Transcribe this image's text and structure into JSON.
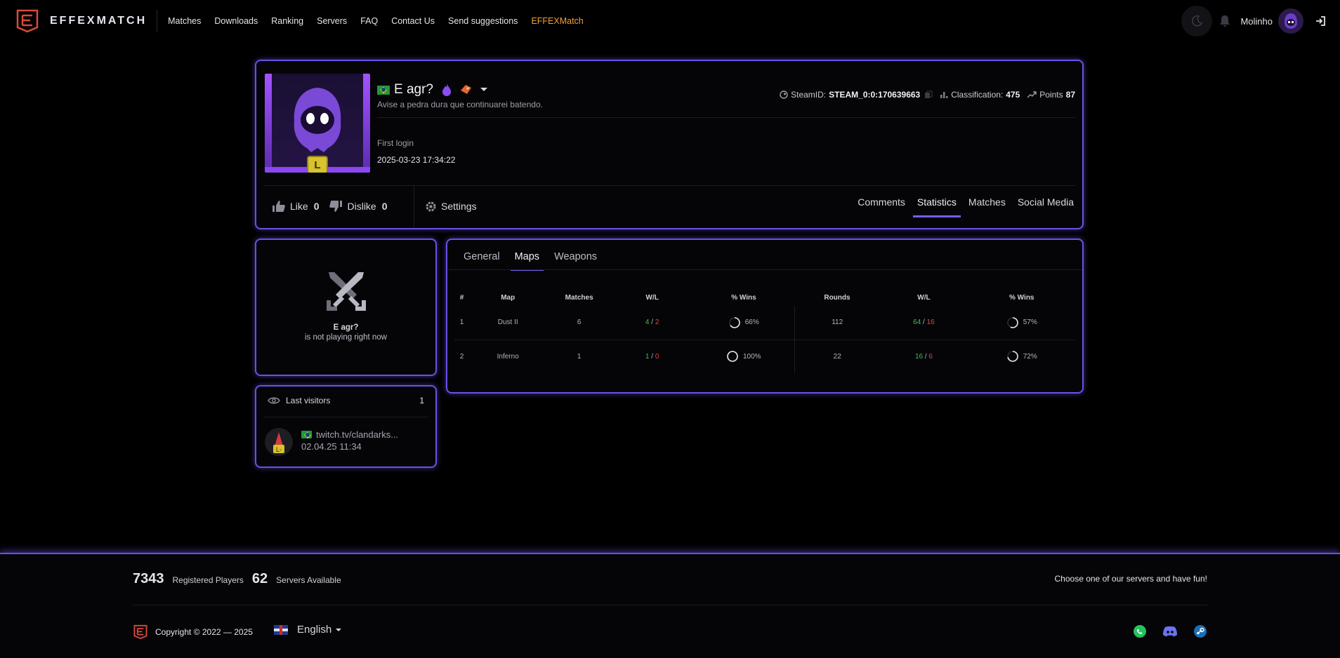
{
  "brand": {
    "name": "EFFEXMATCH",
    "accent": "#6b50e6",
    "brand_link_color": "#f0a23c"
  },
  "nav": {
    "links": [
      "Matches",
      "Downloads",
      "Ranking",
      "Servers",
      "FAQ",
      "Contact Us",
      "Send suggestions",
      "EFFEXMatch"
    ],
    "username": "Molinho"
  },
  "profile": {
    "name": "E agr?",
    "bio": "Avise a pedra dura que continuarei batendo.",
    "level": "L",
    "steamid_label": "SteamID:",
    "steamid": "STEAM_0:0:170639663",
    "classification_label": "Classification:",
    "classification": "475",
    "points_label": "Points",
    "points": "87",
    "first_login_label": "First login",
    "first_login": "2025-03-23 17:34:22",
    "like_label": "Like",
    "like_count": "0",
    "dislike_label": "Dislike",
    "dislike_count": "0",
    "settings_label": "Settings",
    "tabs": [
      "Comments",
      "Statistics",
      "Matches",
      "Social Media"
    ]
  },
  "status": {
    "name": "E agr?",
    "text": "is not playing right now"
  },
  "visitors": {
    "title": "Last visitors",
    "count": "1",
    "items": [
      {
        "name": "twitch.tv/clandarks...",
        "date": "02.04.25 11:34"
      }
    ]
  },
  "stats": {
    "tabs": [
      "General",
      "Maps",
      "Weapons"
    ],
    "columns": [
      "#",
      "Map",
      "Matches",
      "W/L",
      "% Wins",
      "Rounds",
      "W/L",
      "% Wins"
    ],
    "rows": [
      {
        "n": "1",
        "map": "Dust II",
        "matches": "6",
        "w": "4",
        "l": "2",
        "pct": "66%",
        "pct_value": 66,
        "rounds": "112",
        "rw": "64",
        "rl": "16",
        "rpct": "57%",
        "rpct_value": 57
      },
      {
        "n": "2",
        "map": "Inferno",
        "matches": "1",
        "w": "1",
        "l": "0",
        "pct": "100%",
        "pct_value": 100,
        "rounds": "22",
        "rw": "16",
        "rl": "6",
        "rpct": "72%",
        "rpct_value": 72
      }
    ]
  },
  "footer": {
    "players": "7343",
    "players_label": "Registered Players",
    "servers": "62",
    "servers_label": "Servers Available",
    "tagline": "Choose one of our servers and have fun!",
    "copyright": "Copyright © 2022 — 2025",
    "language": "English",
    "social": [
      "whatsapp-icon",
      "discord-icon",
      "steam-icon"
    ]
  }
}
